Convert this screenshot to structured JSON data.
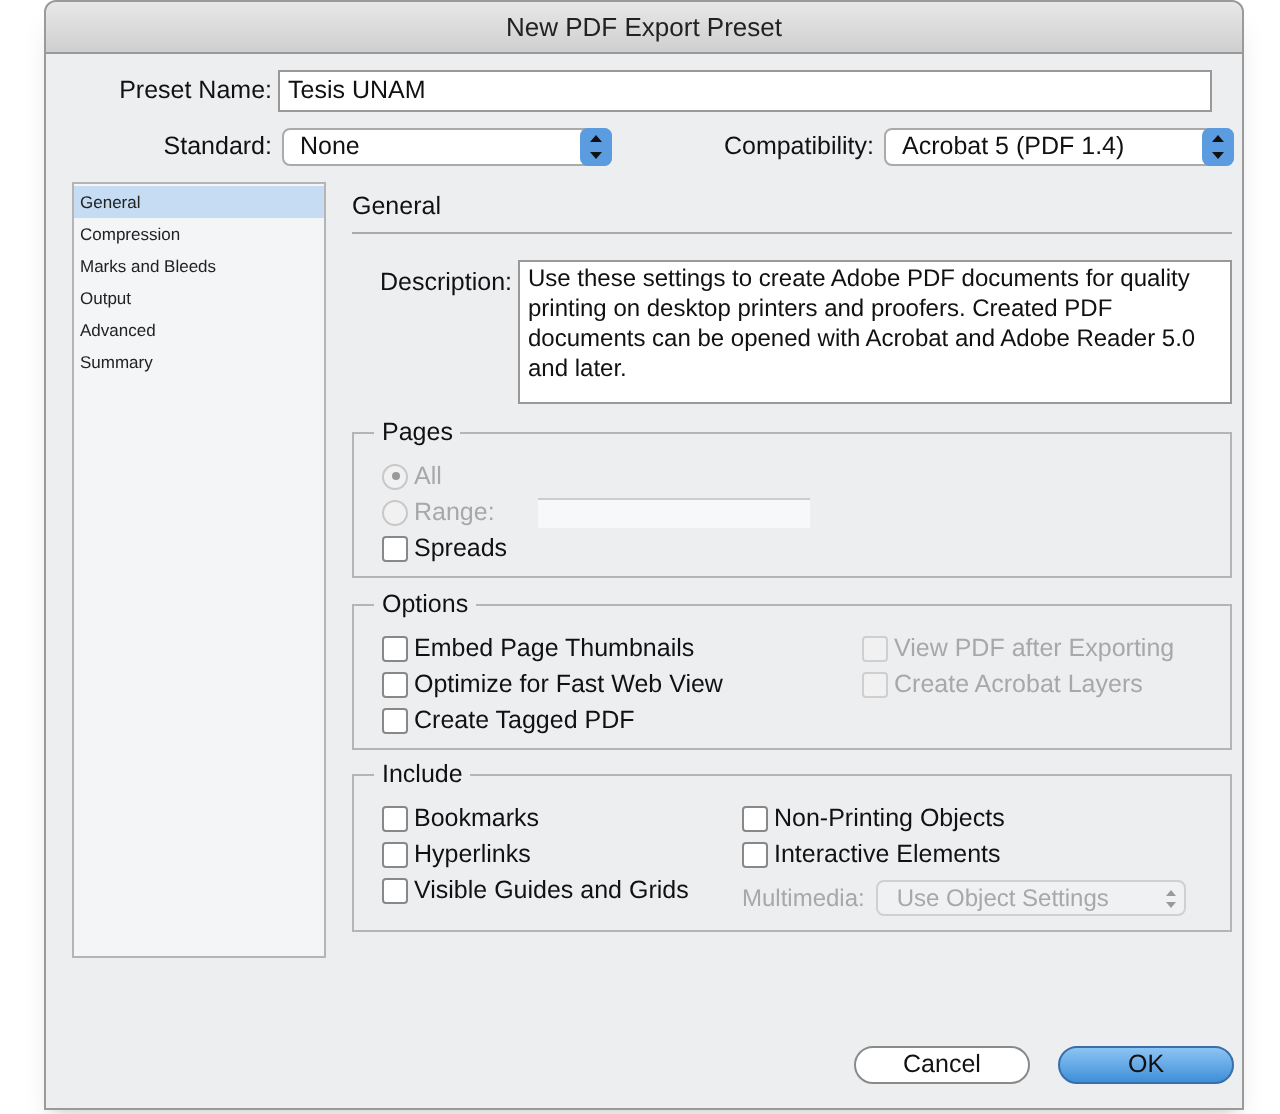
{
  "window": {
    "title": "New PDF Export Preset"
  },
  "preset_name": {
    "label": "Preset Name:",
    "value": "Tesis UNAM"
  },
  "standard": {
    "label": "Standard:",
    "value": "None"
  },
  "compatibility": {
    "label": "Compatibility:",
    "value": "Acrobat 5 (PDF 1.4)"
  },
  "sidebar": {
    "items": [
      {
        "label": "General",
        "selected": true
      },
      {
        "label": "Compression",
        "selected": false
      },
      {
        "label": "Marks and Bleeds",
        "selected": false
      },
      {
        "label": "Output",
        "selected": false
      },
      {
        "label": "Advanced",
        "selected": false
      },
      {
        "label": "Summary",
        "selected": false
      }
    ]
  },
  "section_title": "General",
  "description": {
    "label": "Description:",
    "value": "Use these settings to create Adobe PDF documents for quality printing on desktop printers and proofers.  Created PDF documents can be opened with Acrobat and Adobe Reader 5.0 and later."
  },
  "groups": [
    {
      "title": "Pages",
      "columns": [
        [
          {
            "kind": "radio",
            "label": "All",
            "selected": true,
            "disabled": true
          },
          {
            "kind": "radio_field",
            "label": "Range:",
            "selected": false,
            "disabled": true
          },
          {
            "kind": "checkbox",
            "label": "Spreads",
            "checked": false,
            "disabled": false
          }
        ]
      ]
    },
    {
      "title": "Options",
      "columns": [
        [
          {
            "kind": "checkbox",
            "label": "Embed Page Thumbnails",
            "checked": false,
            "disabled": false
          },
          {
            "kind": "checkbox",
            "label": "Optimize for Fast Web View",
            "checked": false,
            "disabled": false
          },
          {
            "kind": "checkbox",
            "label": "Create Tagged PDF",
            "checked": false,
            "disabled": false
          }
        ],
        [
          {
            "kind": "checkbox",
            "label": "View PDF after Exporting",
            "checked": false,
            "disabled": true
          },
          {
            "kind": "checkbox",
            "label": "Create Acrobat Layers",
            "checked": false,
            "disabled": true
          }
        ]
      ]
    },
    {
      "title": "Include",
      "columns": [
        [
          {
            "kind": "checkbox",
            "label": "Bookmarks",
            "checked": false,
            "disabled": false
          },
          {
            "kind": "checkbox",
            "label": "Hyperlinks",
            "checked": false,
            "disabled": false
          },
          {
            "kind": "checkbox",
            "label": "Visible Guides and Grids",
            "checked": false,
            "disabled": false
          }
        ],
        [
          {
            "kind": "checkbox",
            "label": "Non-Printing Objects",
            "checked": false,
            "disabled": false
          },
          {
            "kind": "checkbox",
            "label": "Interactive Elements",
            "checked": false,
            "disabled": false
          },
          {
            "kind": "select",
            "label": "Multimedia:",
            "value": "Use Object Settings",
            "disabled": true
          }
        ]
      ]
    }
  ],
  "buttons": [
    {
      "label": "Cancel",
      "kind": "normal"
    },
    {
      "label": "OK",
      "kind": "default"
    }
  ]
}
